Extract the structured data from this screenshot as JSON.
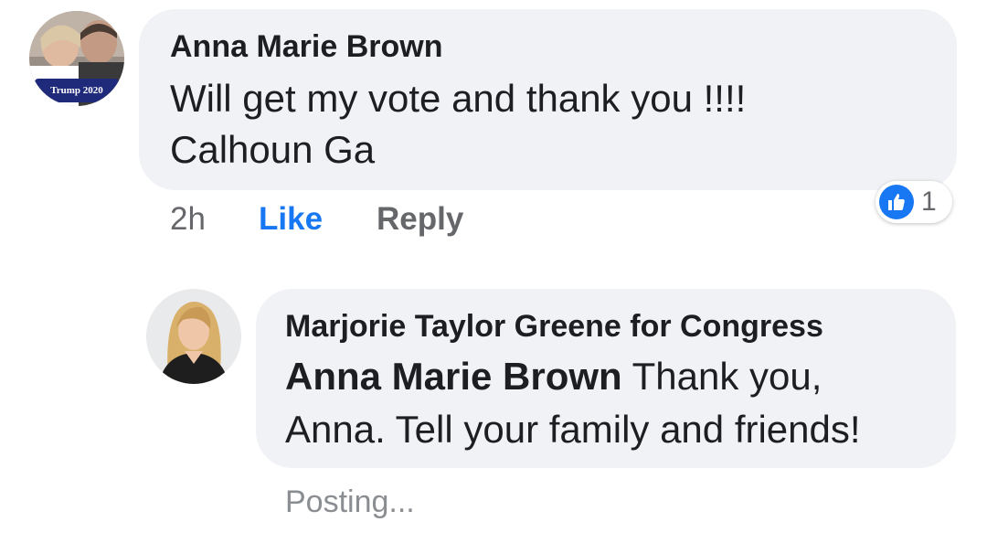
{
  "comment": {
    "author": "Anna Marie Brown",
    "avatar_badge": "Trump 2020",
    "text_line1": "Will get my vote and thank you !!!!",
    "text_line2": "Calhoun Ga",
    "time": "2h",
    "like_label": "Like",
    "reply_label": "Reply",
    "reaction_count": "1",
    "reaction_icon": "thumbs-up-icon"
  },
  "reply": {
    "author": "Marjorie Taylor Greene for Congress",
    "mention": "Anna Marie Brown",
    "text_after_mention": " Thank you,",
    "text_line2": "Anna. Tell your family and friends!",
    "status": "Posting..."
  },
  "colors": {
    "bubble": "#f0f2f5",
    "like_blue": "#1877f2",
    "secondary_text": "#65676b"
  }
}
